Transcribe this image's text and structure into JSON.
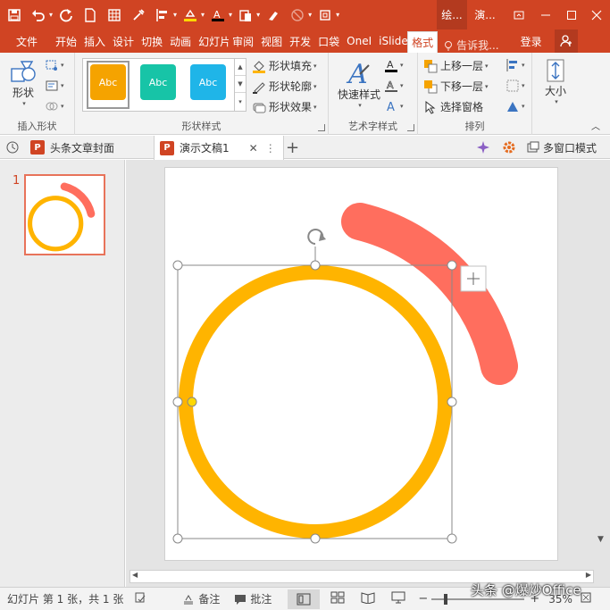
{
  "title_bar": {
    "context_tab_title": "绘...",
    "document_title": "演..."
  },
  "ribbon_tabs": [
    {
      "label": "文件"
    },
    {
      "label": "开始"
    },
    {
      "label": "插入"
    },
    {
      "label": "设计"
    },
    {
      "label": "切换"
    },
    {
      "label": "动画"
    },
    {
      "label": "幻灯片"
    },
    {
      "label": "审阅"
    },
    {
      "label": "视图"
    },
    {
      "label": "开发"
    },
    {
      "label": "口袋"
    },
    {
      "label": "OneI"
    },
    {
      "label": "iSlide"
    },
    {
      "label": "格式",
      "active": true
    }
  ],
  "tell_me": "告诉我...",
  "login": "登录",
  "ribbon": {
    "insert_shapes": {
      "shapes_label": "形状",
      "group_label": "插入形状"
    },
    "shape_styles": {
      "gallery": [
        {
          "text": "Abc",
          "color": "#f5a300"
        },
        {
          "text": "Abc",
          "color": "#17c4a7"
        },
        {
          "text": "Abc",
          "color": "#1fb5e8"
        }
      ],
      "fill": "形状填充",
      "outline": "形状轮廓",
      "effects": "形状效果",
      "group_label": "形状样式"
    },
    "wordart": {
      "quick_styles": "快速样式",
      "group_label": "艺术字样式"
    },
    "arrange": {
      "bring_forward": "上移一层",
      "send_backward": "下移一层",
      "selection_pane": "选择窗格",
      "group_label": "排列"
    },
    "size": {
      "label": "大小"
    }
  },
  "doc_tabs": [
    {
      "label": "头条文章封面",
      "active": false
    },
    {
      "label": "演示文稿1",
      "active": true
    }
  ],
  "multi_window": "多窗口模式",
  "thumbnail_number": "1",
  "status": {
    "slide_info": "幻灯片 第 1 张，共 1 张",
    "notes": "备注",
    "comments": "批注",
    "zoom": "35%",
    "watermark": "头条 @爆炒Office"
  },
  "colors": {
    "brand": "#d04423",
    "circle": "#ffb400",
    "arc": "#ff6e5e"
  }
}
